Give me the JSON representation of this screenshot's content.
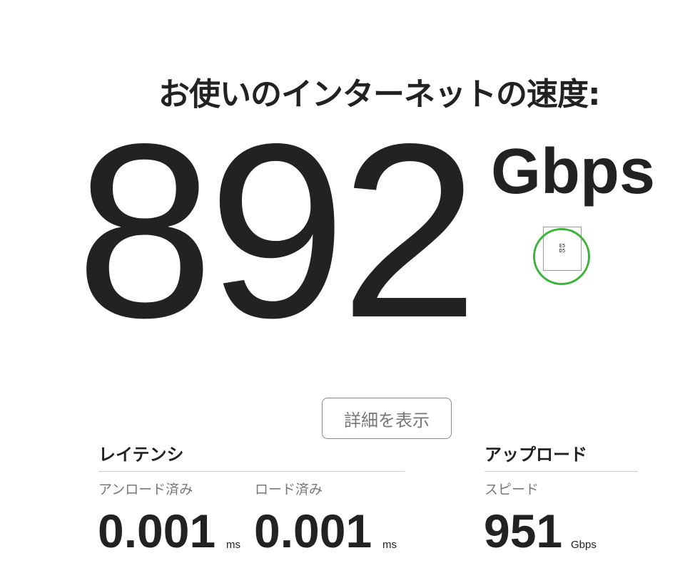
{
  "headline": "お使いのインターネットの速度:",
  "speed": {
    "value": "892",
    "unit": "Gbps"
  },
  "indicator": {
    "text": "E5 D5",
    "ring_color": "#3cb43c"
  },
  "details_button": {
    "label": "詳細を表示"
  },
  "latency": {
    "title": "レイテンシ",
    "unloaded": {
      "label": "アンロード済み",
      "value": "0.001",
      "unit": "ms"
    },
    "loaded": {
      "label": "ロード済み",
      "value": "0.001",
      "unit": "ms"
    }
  },
  "upload": {
    "title": "アップロード",
    "speed": {
      "label": "スピード",
      "value": "951",
      "unit": "Gbps"
    }
  }
}
